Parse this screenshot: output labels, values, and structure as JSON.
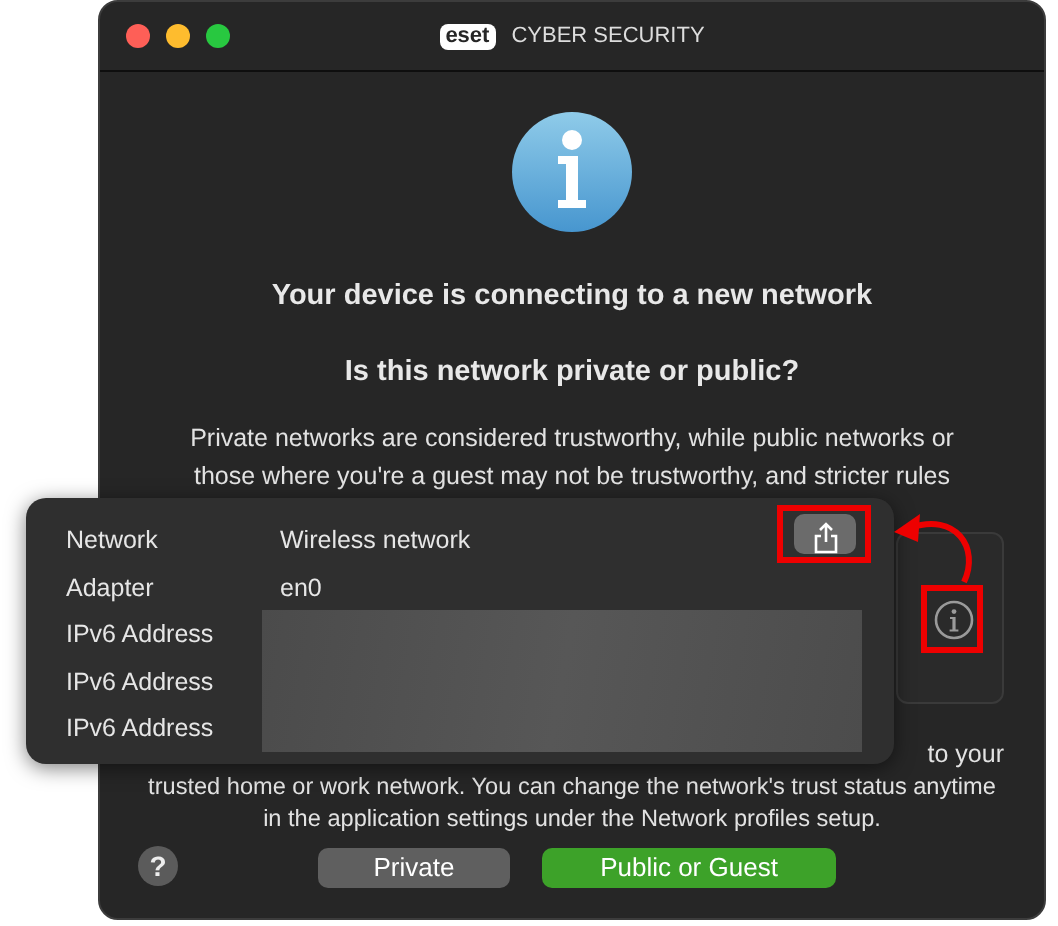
{
  "window": {
    "logo": "eset",
    "title": "CYBER SECURITY"
  },
  "heading": "Your device is connecting to a new network",
  "question": "Is this network private or public?",
  "paragraph_top": [
    "Private networks are considered trustworthy, while public networks or",
    "those where you're a guest may not be trustworthy, and stricter rules"
  ],
  "paragraph_tail": "to your",
  "paragraph_bottom": [
    "trusted home or work network. You can change the network's trust status anytime",
    "in the application settings under the Network profiles setup."
  ],
  "buttons": [
    {
      "label": "Private",
      "kind": "secondary"
    },
    {
      "label": "Public or Guest",
      "kind": "primary"
    }
  ],
  "help": "?",
  "details_popover": {
    "rows": [
      {
        "label": "Network",
        "value": "Wireless network",
        "redacted": false
      },
      {
        "label": "Adapter",
        "value": "en0",
        "redacted": false
      },
      {
        "label": "IPv6 Address",
        "redacted": true
      },
      {
        "label": "IPv6 Address",
        "redacted": true
      },
      {
        "label": "IPv6 Address",
        "redacted": true
      }
    ]
  }
}
